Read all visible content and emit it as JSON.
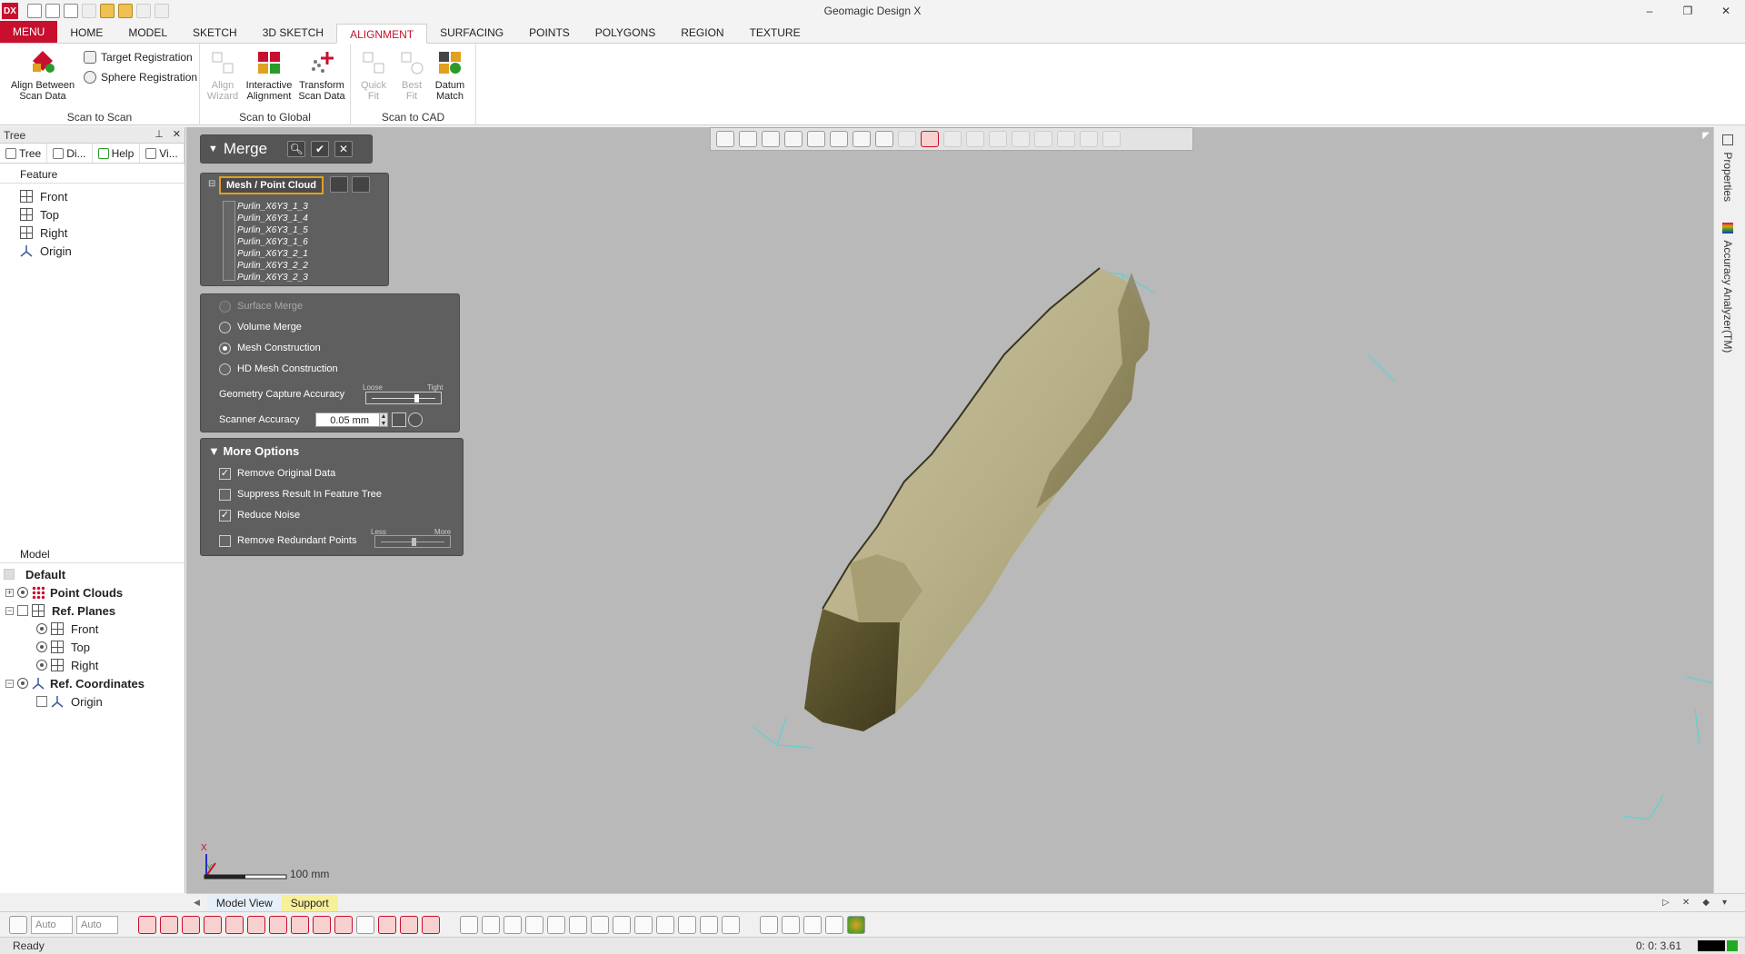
{
  "app": {
    "title": "Geomagic Design X",
    "logo": "DX",
    "window_buttons": [
      "–",
      "❐",
      "✕"
    ]
  },
  "ribbon": {
    "tabs": [
      "MENU",
      "HOME",
      "MODEL",
      "SKETCH",
      "3D SKETCH",
      "ALIGNMENT",
      "SURFACING",
      "POINTS",
      "POLYGONS",
      "REGION",
      "TEXTURE"
    ],
    "active_tab": "ALIGNMENT",
    "groups": {
      "scan_to_scan": {
        "title": "Scan to Scan",
        "align_between": "Align Between\nScan Data",
        "target_registration": "Target Registration",
        "sphere_registration": "Sphere Registration"
      },
      "scan_to_global": {
        "title": "Scan to Global",
        "align_wizard": "Align\nWizard",
        "interactive_alignment": "Interactive\nAlignment",
        "transform_scan_data": "Transform\nScan Data"
      },
      "scan_to_cad": {
        "title": "Scan to CAD",
        "quick_fit": "Quick\nFit",
        "best_fit": "Best\nFit",
        "datum_match": "Datum\nMatch"
      }
    }
  },
  "left_panel": {
    "title": "Tree",
    "tabs": [
      "Tree",
      "Di...",
      "Help",
      "Vi..."
    ],
    "feature_label": "Feature",
    "feature_items": [
      "Front",
      "Top",
      "Right",
      "Origin"
    ],
    "model_label": "Model",
    "model_default": "Default",
    "model_items": {
      "point_clouds": "Point Clouds",
      "ref_planes": "Ref. Planes",
      "planes": [
        "Front",
        "Top",
        "Right"
      ],
      "ref_coordinates": "Ref. Coordinates",
      "origin": "Origin"
    }
  },
  "merge": {
    "title": "Merge",
    "mesh_label": "Mesh / Point Cloud",
    "scans": [
      "Purlin_X6Y3_1_3",
      "Purlin_X6Y3_1_4",
      "Purlin_X6Y3_1_5",
      "Purlin_X6Y3_1_6",
      "Purlin_X6Y3_2_1",
      "Purlin_X6Y3_2_2",
      "Purlin_X6Y3_2_3"
    ],
    "options": {
      "surface_merge": "Surface Merge",
      "volume_merge": "Volume Merge",
      "mesh_construction": "Mesh Construction",
      "hd_mesh_construction": "HD Mesh Construction",
      "selected": "Mesh Construction"
    },
    "geometry_capture_label": "Geometry Capture Accuracy",
    "loose": "Loose",
    "tight": "Tight",
    "geometry_capture_level": 0.7,
    "scanner_accuracy_label": "Scanner Accuracy",
    "scanner_accuracy_value": "0.05 mm",
    "more_options_title": "More Options",
    "remove_original": "Remove Original Data",
    "suppress_result": "Suppress Result In Feature Tree",
    "reduce_noise": "Reduce Noise",
    "remove_redundant": "Remove Redundant Points",
    "less": "Less",
    "more": "More",
    "redundant_level": 0.5,
    "checked": {
      "remove_original": true,
      "suppress_result": false,
      "reduce_noise": true,
      "remove_redundant": false
    }
  },
  "viewport": {
    "scale_label": "100 mm",
    "axis_x": "X",
    "axis_y": "Y"
  },
  "right_tabs": [
    "Properties",
    "Accuracy Analyzer(TM)"
  ],
  "view_tabs": [
    "Model View",
    "Support"
  ],
  "bottom": {
    "auto1": "Auto",
    "auto2": "Auto"
  },
  "status": {
    "text": "Ready",
    "time": "0: 0: 3.61"
  },
  "colors": {
    "accent": "#c8102e",
    "viewport_bg": "#b9b9b9",
    "dialog_bg": "#5f5f5f",
    "highlight": "#e0a020"
  }
}
